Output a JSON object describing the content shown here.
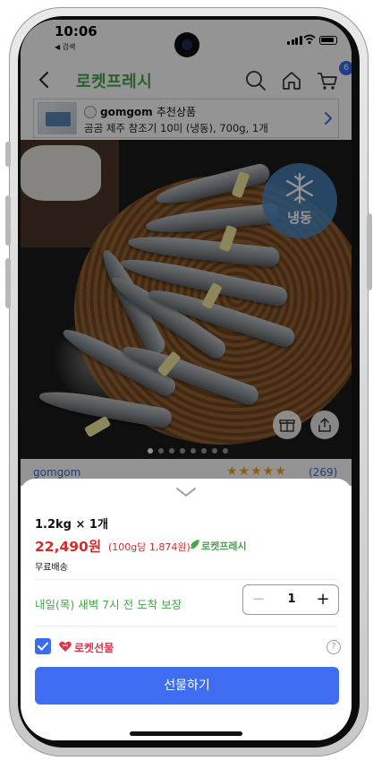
{
  "status_bar": {
    "time": "10:06",
    "back_label": "◀ 검색"
  },
  "nav": {
    "title": "로켓프레시",
    "cart_count": "6"
  },
  "recommendation": {
    "brand": "gomgom",
    "label": "추천상품",
    "description": "곰곰 제주 참조기 10미 (냉동), 700g, 1개"
  },
  "hero": {
    "badge_label": "냉동",
    "slide_count": 8,
    "active_slide": 0
  },
  "product_row": {
    "brand": "gomgom",
    "stars": "★★★★★",
    "review_count": "(269)"
  },
  "sheet": {
    "option": "1.2kg × 1개",
    "price": "22,490원",
    "unit_price": "(100g당 1,874원)",
    "rocket_tag": "로켓프레시",
    "shipping": "무료배송",
    "delivery": "내일(목) 새벽 7시 전 도착 보장",
    "quantity": "1",
    "minus": "−",
    "plus": "+",
    "gift_label": "로켓선물",
    "help": "?",
    "cta": "선물하기"
  },
  "colors": {
    "accent_blue": "#3f6df2",
    "fresh_green": "#45a64b",
    "price_red": "#d32c2c",
    "gift_red": "#e0324b"
  }
}
